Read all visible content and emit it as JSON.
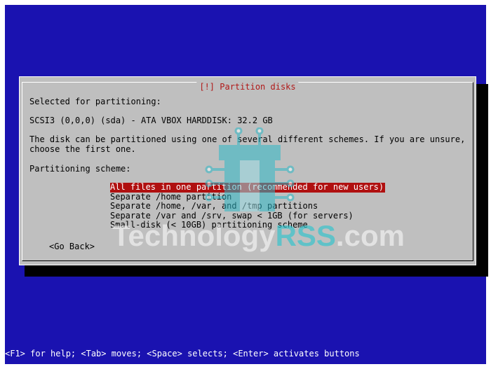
{
  "dialog": {
    "title": "[!] Partition disks",
    "selected_label": "Selected for partitioning:",
    "disk": "SCSI3 (0,0,0) (sda) - ATA VBOX HARDDISK: 32.2 GB",
    "description_line1": "The disk can be partitioned using one of several different schemes. If you are unsure,",
    "description_line2": "choose the first one.",
    "scheme_label": "Partitioning scheme:",
    "options": [
      "All files in one partition (recommended for new users)",
      "Separate /home partition",
      "Separate /home, /var, and /tmp partitions",
      "Separate /var and /srv, swap < 1GB (for servers)",
      "Small-disk (< 10GB) partitioning scheme"
    ],
    "selected_index": 0,
    "go_back": "<Go Back>"
  },
  "watermark": {
    "part1": "Technology",
    "part2": "RSS",
    "part3": ".com"
  },
  "helpbar": "<F1> for help; <Tab> moves; <Space> selects; <Enter> activates buttons",
  "colors": {
    "background": "#1a12b0",
    "dialog": "#bfbfbf",
    "highlight": "#b01010",
    "title": "#b01818"
  }
}
